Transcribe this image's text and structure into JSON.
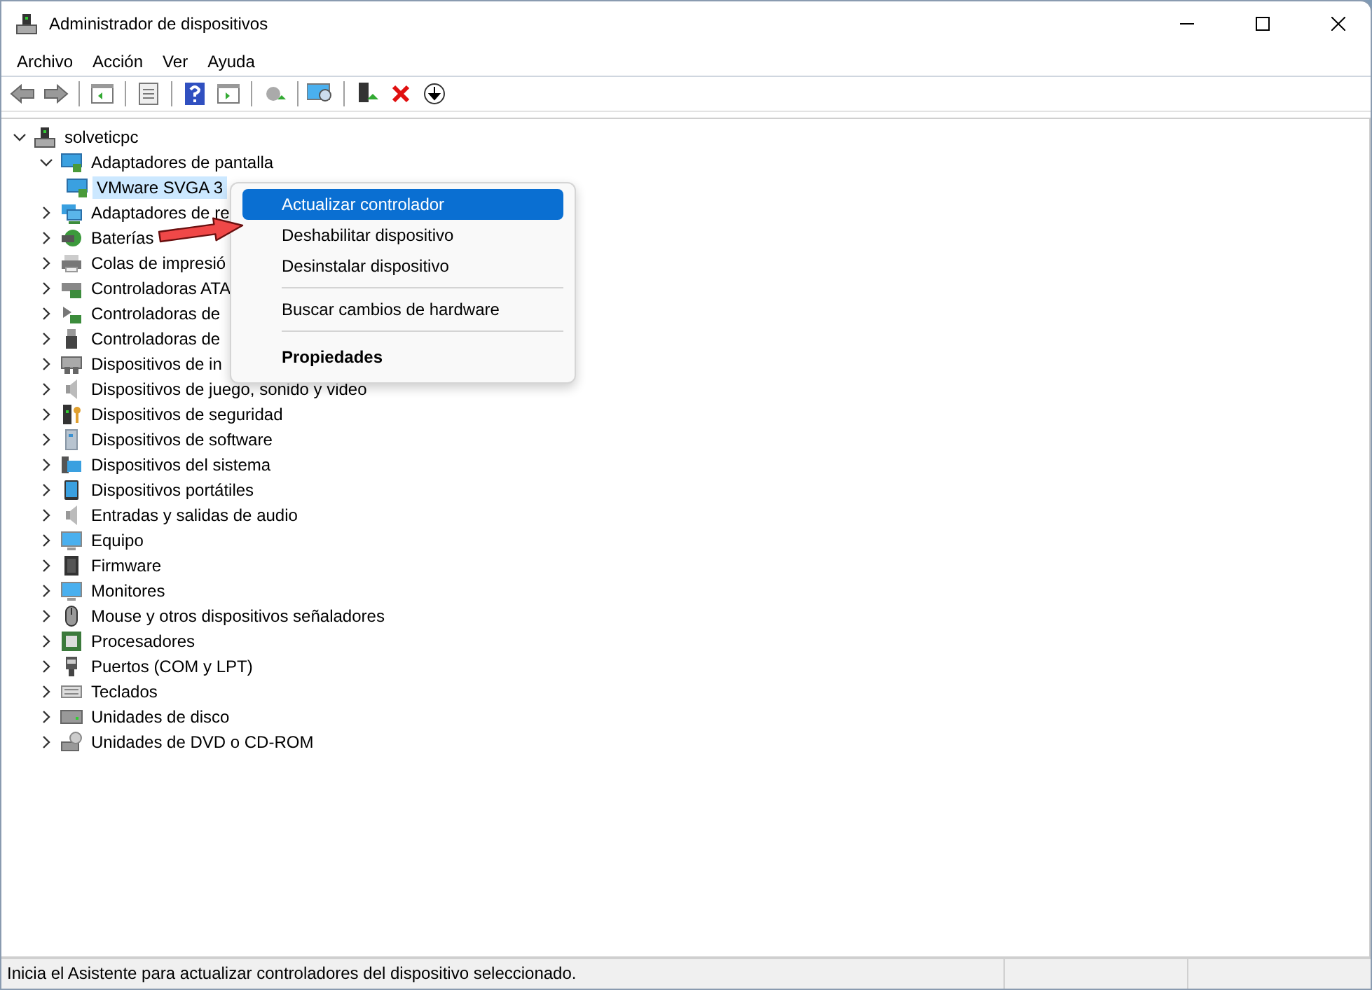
{
  "window": {
    "title": "Administrador de dispositivos"
  },
  "menu_bar": [
    "Archivo",
    "Acción",
    "Ver",
    "Ayuda"
  ],
  "tree": {
    "label": "solveticpc",
    "expanded": true,
    "children": [
      {
        "label": "Adaptadores de pantalla",
        "expanded": true,
        "children": [
          {
            "label": "VMware SVGA 3",
            "selected": true
          }
        ]
      },
      {
        "label": "Adaptadores de re",
        "expanded": false
      },
      {
        "label": "Baterías",
        "expanded": false
      },
      {
        "label": "Colas de impresió",
        "expanded": false
      },
      {
        "label": "Controladoras ATA",
        "expanded": false
      },
      {
        "label": "Controladoras de",
        "expanded": false
      },
      {
        "label": "Controladoras de",
        "expanded": false
      },
      {
        "label": "Dispositivos de in",
        "expanded": false
      },
      {
        "label": "Dispositivos de juego, sonido y video",
        "expanded": false
      },
      {
        "label": "Dispositivos de seguridad",
        "expanded": false
      },
      {
        "label": "Dispositivos de software",
        "expanded": false
      },
      {
        "label": "Dispositivos del sistema",
        "expanded": false
      },
      {
        "label": "Dispositivos portátiles",
        "expanded": false
      },
      {
        "label": "Entradas y salidas de audio",
        "expanded": false
      },
      {
        "label": "Equipo",
        "expanded": false
      },
      {
        "label": "Firmware",
        "expanded": false
      },
      {
        "label": "Monitores",
        "expanded": false
      },
      {
        "label": "Mouse y otros dispositivos señaladores",
        "expanded": false
      },
      {
        "label": "Procesadores",
        "expanded": false
      },
      {
        "label": "Puertos (COM y LPT)",
        "expanded": false
      },
      {
        "label": "Teclados",
        "expanded": false
      },
      {
        "label": "Unidades de disco",
        "expanded": false
      },
      {
        "label": "Unidades de DVD o CD-ROM",
        "expanded": false
      }
    ]
  },
  "context_menu": [
    {
      "kind": "item",
      "label": "Actualizar controlador",
      "selected": true
    },
    {
      "kind": "item",
      "label": "Deshabilitar dispositivo",
      "selected": false
    },
    {
      "kind": "item",
      "label": "Desinstalar dispositivo",
      "selected": false
    },
    {
      "kind": "separator"
    },
    {
      "kind": "item",
      "label": "Buscar cambios de hardware",
      "selected": false
    },
    {
      "kind": "separator"
    },
    {
      "kind": "default",
      "label": "Propiedades",
      "selected": false
    }
  ],
  "status_bar": {
    "text": "Inicia el Asistente para actualizar controladores del dispositivo seleccionado."
  }
}
